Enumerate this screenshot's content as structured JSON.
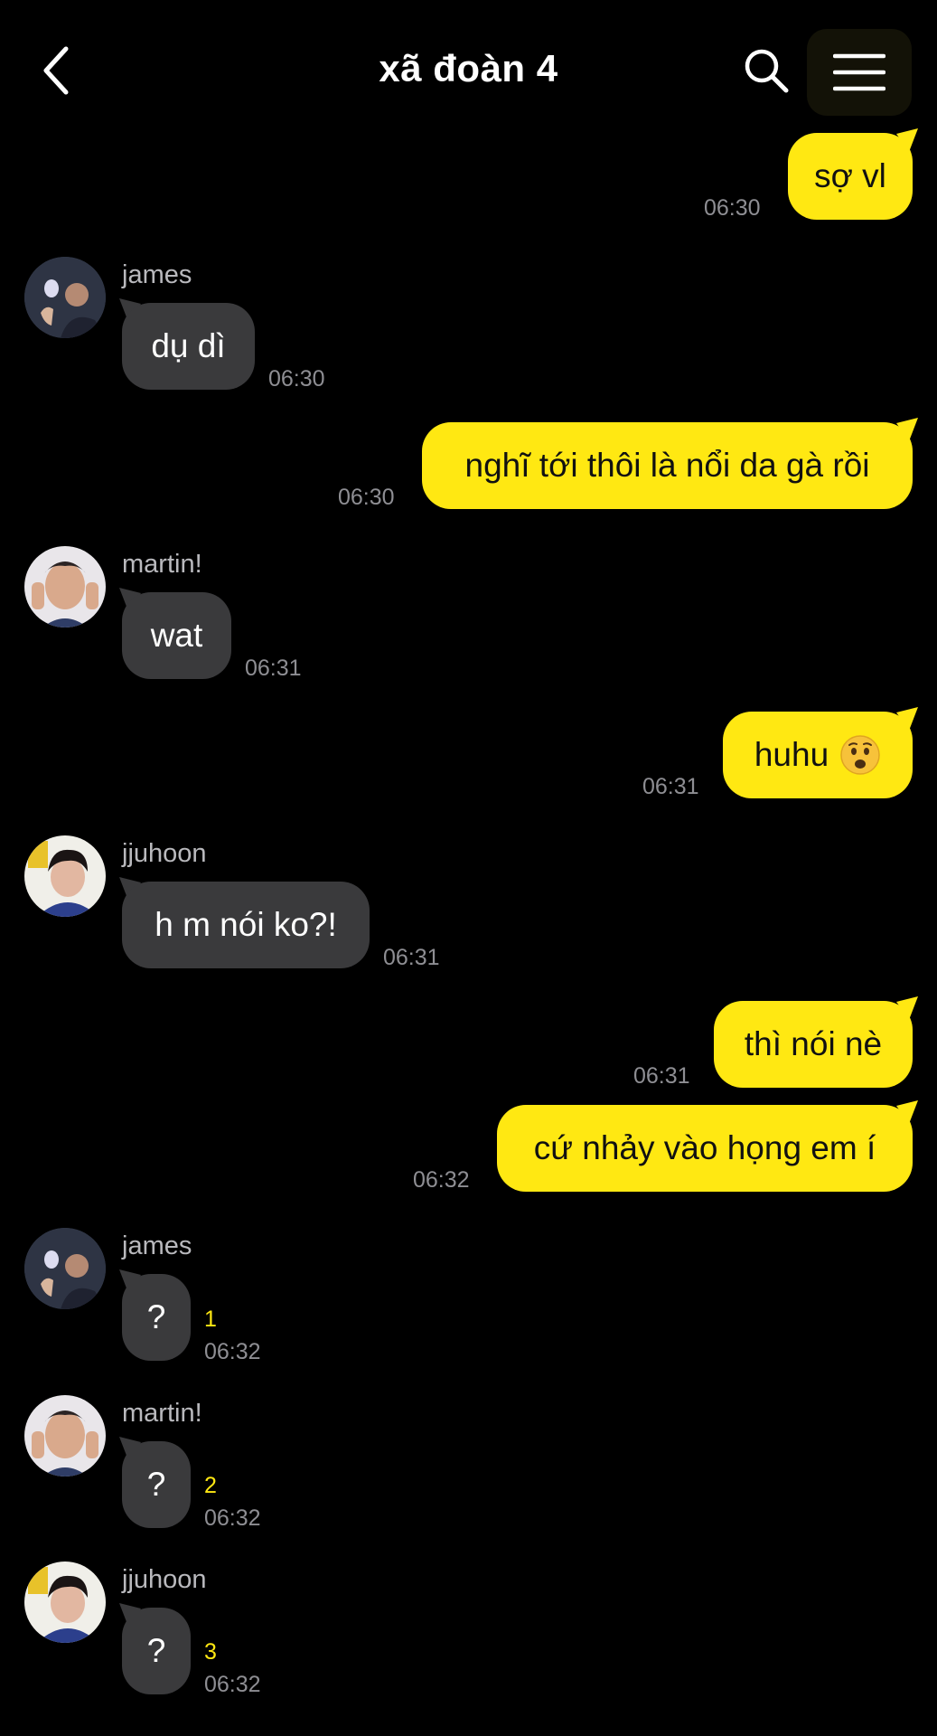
{
  "header": {
    "title": "xã đoàn 4",
    "back_icon": "chevron-left-icon",
    "search_icon": "search-icon",
    "menu_icon": "hamburger-menu-icon"
  },
  "colors": {
    "background": "#000000",
    "my_bubble": "#ffe812",
    "their_bubble": "#3a3a3c",
    "timestamp": "#8e8e93",
    "unread_count": "#ffe812",
    "sender_name": "#b9b9bd"
  },
  "messages": [
    {
      "from": "me",
      "text": "sợ vl",
      "time": "06:30"
    },
    {
      "from": "james",
      "sender": "james",
      "text": "dụ dì",
      "time": "06:30"
    },
    {
      "from": "me",
      "text": "nghĩ tới thôi là nổi da gà rồi",
      "time": "06:30"
    },
    {
      "from": "martin!",
      "sender": "martin!",
      "text": "wat",
      "time": "06:31"
    },
    {
      "from": "me",
      "text": "huhu",
      "emoji": "anguished-face-emoji",
      "time": "06:31"
    },
    {
      "from": "jjuhoon",
      "sender": "jjuhoon",
      "text": "h m nói ko?!",
      "time": "06:31"
    },
    {
      "from": "me",
      "text": "thì nói nè",
      "time": "06:31"
    },
    {
      "from": "me",
      "text": "cứ nhảy vào họng em í",
      "time": "06:32"
    },
    {
      "from": "james",
      "sender": "james",
      "text": "?",
      "unread": "1",
      "time": "06:32"
    },
    {
      "from": "martin!",
      "sender": "martin!",
      "text": "?",
      "unread": "2",
      "time": "06:32"
    },
    {
      "from": "jjuhoon",
      "sender": "jjuhoon",
      "text": "?",
      "unread": "3",
      "time": "06:32"
    }
  ]
}
